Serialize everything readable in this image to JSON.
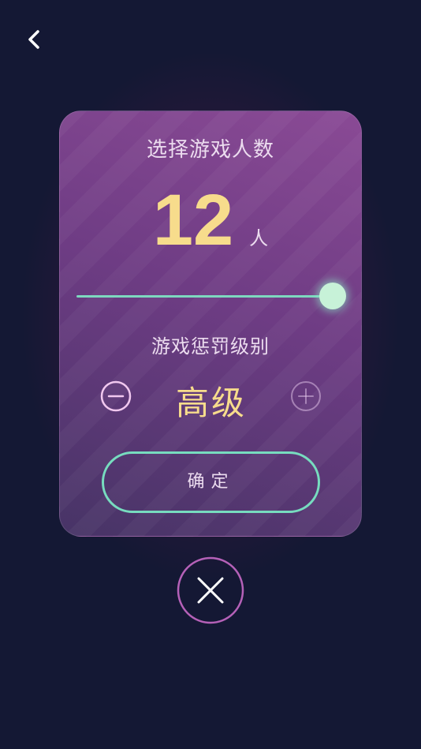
{
  "header": {
    "back_icon": "chevron-left-icon"
  },
  "player_count": {
    "title": "选择游戏人数",
    "value": "12",
    "unit": "人",
    "slider_fraction": 1.0
  },
  "penalty_level": {
    "title": "游戏惩罚级别",
    "value": "高级",
    "decrease_icon": "minus-circle-icon",
    "increase_icon": "plus-circle-icon"
  },
  "confirm": {
    "label": "确定"
  },
  "close": {
    "icon": "close-icon"
  },
  "colors": {
    "background": "#141834",
    "accent_green": "#77dcbf",
    "number_gold": "#f7dc8c",
    "close_ring": "#b561b8"
  }
}
